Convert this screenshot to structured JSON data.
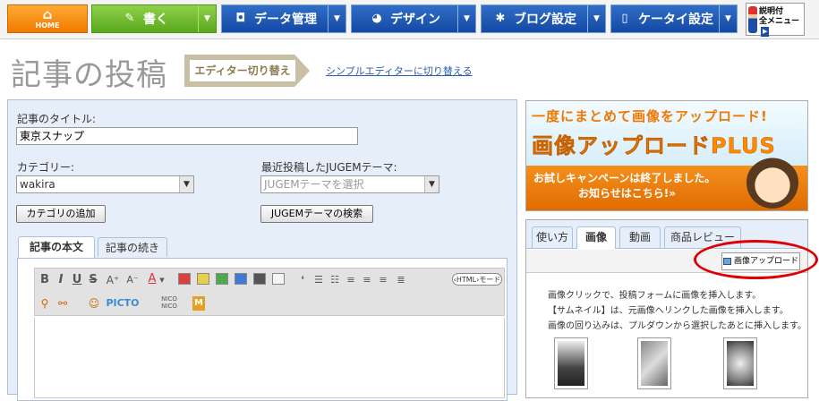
{
  "nav": {
    "home": "HOME",
    "write": "書く",
    "data": "データ管理",
    "design": "デザイン",
    "blog_settings": "ブログ設定",
    "mobile_settings": "ケータイ設定",
    "help_line1": "説明付",
    "help_line2": "全メニュー"
  },
  "page": {
    "title": "記事の投稿",
    "editor_switch": "エディター切り替え",
    "simple_editor_link": "シンプルエディターに切り替える"
  },
  "form": {
    "title_label": "記事のタイトル:",
    "title_value": "東京スナップ",
    "category_label": "カテゴリー:",
    "category_value": "wakira",
    "add_category": "カテゴリの追加",
    "theme_label": "最近投稿したJUGEMテーマ:",
    "theme_placeholder": "JUGEMテーマを選択",
    "theme_search": "JUGEMテーマの検索"
  },
  "editor": {
    "tabs": [
      "記事の本文",
      "記事の続き"
    ],
    "active_tab": 0,
    "toolbar": {
      "bold": "B",
      "italic": "I",
      "underline": "U",
      "strike": "S",
      "font_up": "A⁺",
      "font_down": "A⁻",
      "font_color": "A",
      "html_mode": "‹HTML›モード",
      "picto": "PICTO",
      "nico": "NICO NICO",
      "m": "M"
    },
    "swatches": [
      "#d94040",
      "#e6d04a",
      "#4ea84e",
      "#3f7bd6",
      "#555555",
      "#f5f5f5"
    ]
  },
  "banner": {
    "line1": "一度にまとめて画像をアップロード!",
    "line2": "画像アップロードPLUS",
    "line3": "お試しキャンペーンは終了しました。",
    "line4": "お知らせはこちら!»"
  },
  "right_tabs": [
    "使い方",
    "画像",
    "動画",
    "商品レビュー"
  ],
  "right_active_tab": 1,
  "upload_button": "画像アップロード",
  "info": [
    "画像クリックで、投稿フォームに画像を挿入します。",
    "【サムネイル】は、元画像へリンクした画像を挿入します。",
    "画像の回り込みは、プルダウンから選択したあとに挿入します。"
  ],
  "colors": {
    "home": "#f07a00",
    "write": "#5aa81e",
    "nav_blue": "#1549a3",
    "panel_bg": "#e6eef9",
    "highlight": "#e00000"
  }
}
